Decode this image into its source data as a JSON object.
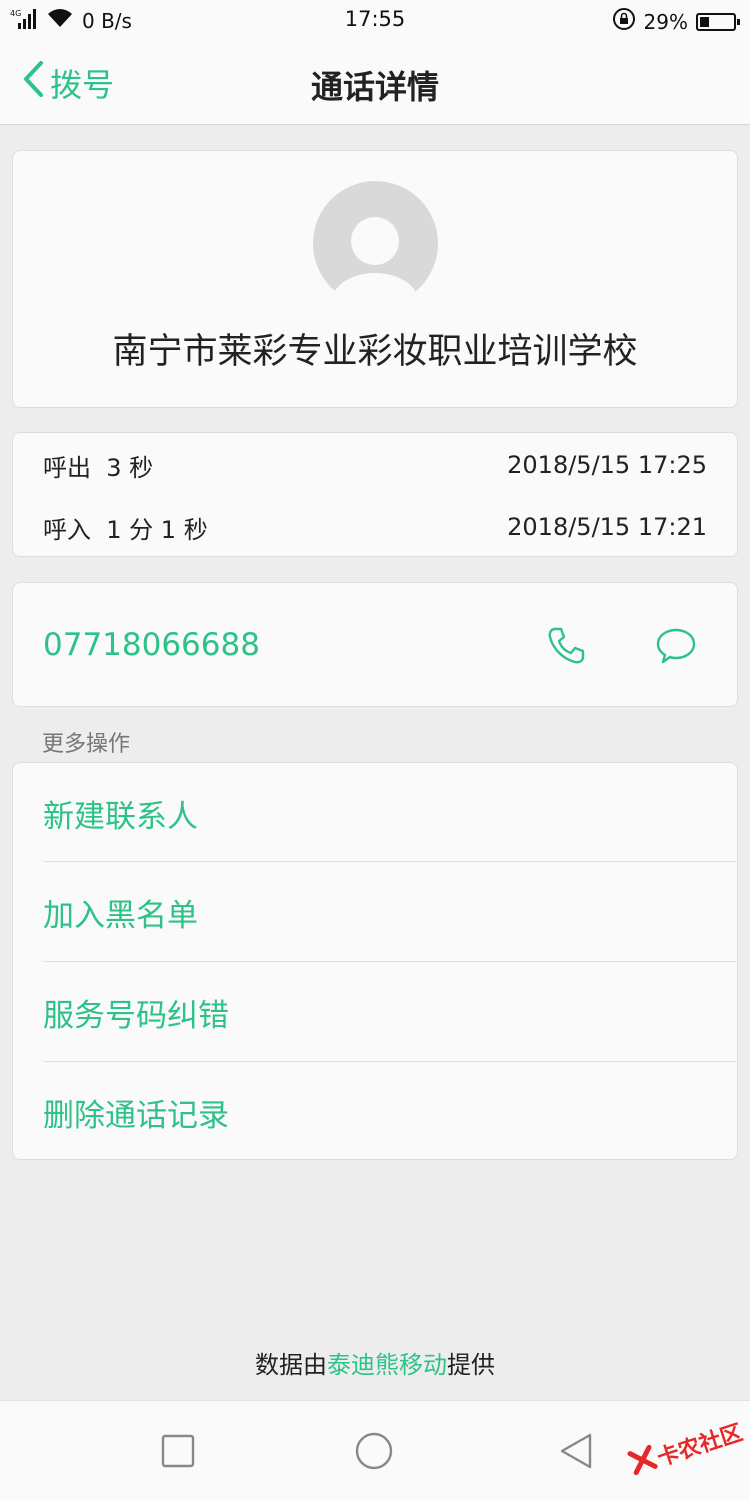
{
  "status_bar": {
    "network": "4G",
    "speed": "0 B/s",
    "time": "17:55",
    "battery_percent": "29%",
    "battery_level": 0.29
  },
  "header": {
    "back_label": "拨号",
    "title": "通话详情"
  },
  "contact": {
    "name": "南宁市莱彩专业彩妆职业培训学校"
  },
  "calls": [
    {
      "type": "呼出",
      "duration": "3 秒",
      "datetime": "2018/5/15 17:25"
    },
    {
      "type": "呼入",
      "duration": "1 分 1 秒",
      "datetime": "2018/5/15 17:21"
    }
  ],
  "number": {
    "value": "07718066688",
    "call_icon": "phone-icon",
    "message_icon": "message-icon"
  },
  "more_actions": {
    "label": "更多操作",
    "items": [
      {
        "label": "新建联系人"
      },
      {
        "label": "加入黑名单"
      },
      {
        "label": "服务号码纠错"
      },
      {
        "label": "删除通话记录"
      }
    ]
  },
  "footer": {
    "prefix": "数据由",
    "brand": "泰迪熊移动",
    "suffix": "提供"
  },
  "watermark": {
    "text": "卡农社区"
  },
  "colors": {
    "accent": "#2ec28a",
    "background": "#ededed",
    "card": "#fafafa"
  }
}
